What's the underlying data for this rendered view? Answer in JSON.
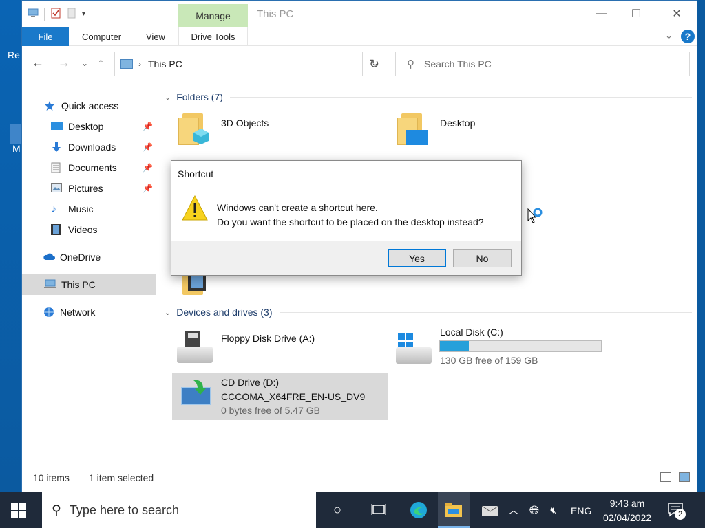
{
  "desktop": {
    "partial_label_1": "Re",
    "partial_label_2": "M"
  },
  "window": {
    "title": "This PC",
    "context_tab": "Manage",
    "controls": {
      "minimize": "—",
      "maximize": "☐",
      "close": "✕"
    }
  },
  "ribbon": {
    "tabs": [
      {
        "label": "File"
      },
      {
        "label": "Computer"
      },
      {
        "label": "View"
      },
      {
        "label": "Drive Tools"
      }
    ],
    "help": "?"
  },
  "navbar": {
    "address_crumb": "This PC",
    "search_placeholder": "Search This PC"
  },
  "sidebar": {
    "items": [
      {
        "label": "Quick access",
        "icon": "star-icon"
      },
      {
        "label": "Desktop",
        "icon": "desktop-folder-icon",
        "pinned": true
      },
      {
        "label": "Downloads",
        "icon": "download-icon",
        "pinned": true
      },
      {
        "label": "Documents",
        "icon": "documents-icon",
        "pinned": true
      },
      {
        "label": "Pictures",
        "icon": "pictures-icon",
        "pinned": true
      },
      {
        "label": "Music",
        "icon": "music-icon"
      },
      {
        "label": "Videos",
        "icon": "videos-icon"
      },
      {
        "label": "OneDrive",
        "icon": "cloud-icon"
      },
      {
        "label": "This PC",
        "icon": "computer-icon",
        "selected": true
      },
      {
        "label": "Network",
        "icon": "network-icon"
      }
    ]
  },
  "content": {
    "folders_header": "Folders (7)",
    "folders": [
      {
        "label": "3D Objects"
      },
      {
        "label": "Desktop"
      }
    ],
    "devices_header": "Devices and drives (3)",
    "drives": [
      {
        "label": "Floppy Disk Drive (A:)"
      },
      {
        "label": "Local Disk (C:)",
        "free": "130 GB free of 159 GB",
        "used_fraction": 0.18
      },
      {
        "label": "CD Drive (D:)",
        "volume": "CCCOMA_X64FRE_EN-US_DV9",
        "free": "0 bytes free of 5.47 GB",
        "selected": true
      }
    ]
  },
  "status": {
    "count": "10 items",
    "selection": "1 item selected"
  },
  "dialog": {
    "title": "Shortcut",
    "line1": "Windows can't create a shortcut here.",
    "line2": "Do you want the shortcut to be placed on the desktop instead?",
    "yes": "Yes",
    "no": "No"
  },
  "taskbar": {
    "search_placeholder": "Type here to search",
    "language": "ENG",
    "time": "9:43 am",
    "date": "02/04/2022",
    "notifications": "2"
  },
  "colors": {
    "accent": "#1979ca",
    "manage_tab": "#c9e8b8",
    "selection": "#d9d9d9",
    "drive_bar": "#26a0da",
    "taskbar": "#1f2a3a"
  }
}
